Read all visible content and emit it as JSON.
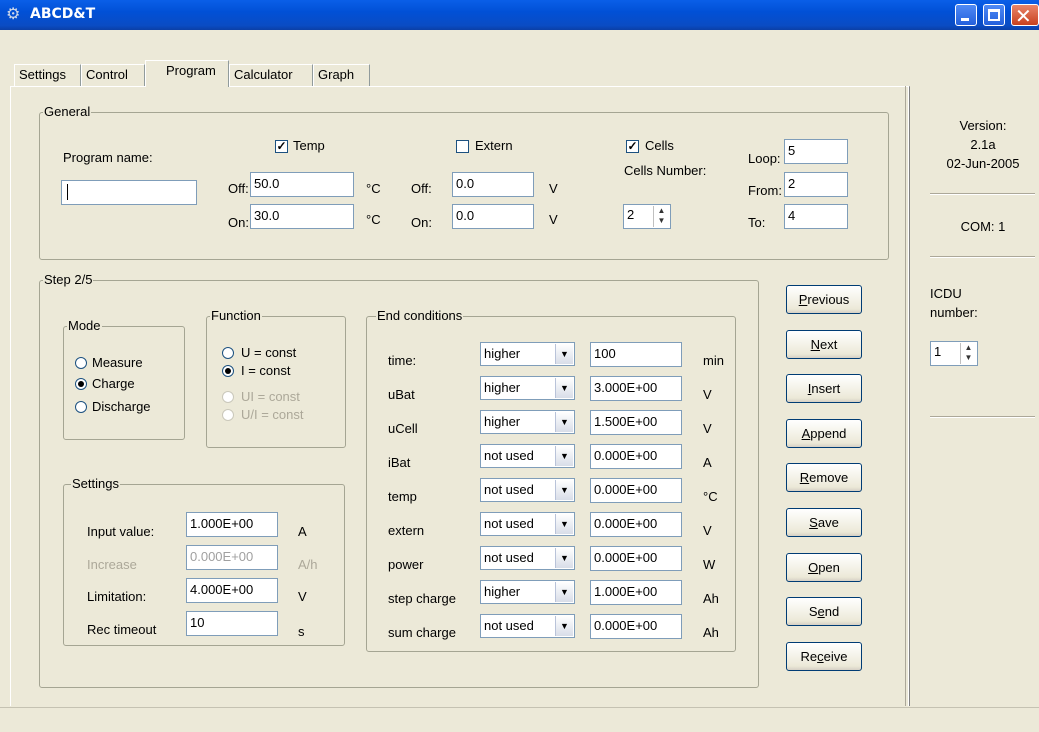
{
  "window": {
    "title": "ABCD&T"
  },
  "tabs": [
    "Settings",
    "Control",
    "Program",
    "Calculator",
    "Graph"
  ],
  "general": {
    "legend": "General",
    "program_name_label": "Program name:",
    "program_name_value": "",
    "temp": {
      "label": "Temp",
      "checked": true,
      "off_label": "Off:",
      "off_value": "50.0",
      "on_label": "On:",
      "on_value": "30.0",
      "unit": "°C"
    },
    "extern": {
      "label": "Extern",
      "checked": false,
      "off_label": "Off:",
      "off_value": "0.0",
      "on_label": "On:",
      "on_value": "0.0",
      "unit": "V"
    },
    "cells": {
      "label": "Cells",
      "checked": true,
      "number_label": "Cells Number:",
      "number_value": "2"
    },
    "loop": {
      "loop_label": "Loop:",
      "loop_value": "5",
      "from_label": "From:",
      "from_value": "2",
      "to_label": "To:",
      "to_value": "4"
    }
  },
  "step": {
    "legend": "Step 2/5",
    "mode": {
      "legend": "Mode",
      "options": [
        "Measure",
        "Charge",
        "Discharge"
      ],
      "selected": "Charge"
    },
    "function": {
      "legend": "Function",
      "options": [
        "U = const",
        "I = const",
        "UI = const",
        "U/I = const"
      ],
      "selected": "I = const"
    },
    "settings": {
      "legend": "Settings",
      "rows": [
        {
          "label": "Input value:",
          "value": "1.000E+00",
          "unit": "A"
        },
        {
          "label": "Increase",
          "value": "0.000E+00",
          "unit": "A/h"
        },
        {
          "label": "Limitation:",
          "value": "4.000E+00",
          "unit": "V"
        },
        {
          "label": "Rec timeout",
          "value": "10",
          "unit": "s"
        }
      ]
    },
    "end_conditions": {
      "legend": "End conditions",
      "rows": [
        {
          "label": "time:",
          "op": "higher",
          "value": "100",
          "unit": "min"
        },
        {
          "label": "uBat",
          "op": "higher",
          "value": "3.000E+00",
          "unit": "V"
        },
        {
          "label": "uCell",
          "op": "higher",
          "value": "1.500E+00",
          "unit": "V"
        },
        {
          "label": "iBat",
          "op": "not used",
          "value": "0.000E+00",
          "unit": "A"
        },
        {
          "label": "temp",
          "op": "not used",
          "value": "0.000E+00",
          "unit": "°C"
        },
        {
          "label": "extern",
          "op": "not used",
          "value": "0.000E+00",
          "unit": "V"
        },
        {
          "label": "power",
          "op": "not used",
          "value": "0.000E+00",
          "unit": "W"
        },
        {
          "label": "step charge",
          "op": "higher",
          "value": "1.000E+00",
          "unit": "Ah"
        },
        {
          "label": "sum charge",
          "op": "not used",
          "value": "0.000E+00",
          "unit": "Ah"
        }
      ]
    }
  },
  "buttons": [
    {
      "name": "previous",
      "pre": "",
      "key": "P",
      "post": "revious"
    },
    {
      "name": "next",
      "pre": "",
      "key": "N",
      "post": "ext"
    },
    {
      "name": "insert",
      "pre": "",
      "key": "I",
      "post": "nsert"
    },
    {
      "name": "append",
      "pre": "",
      "key": "A",
      "post": "ppend"
    },
    {
      "name": "remove",
      "pre": "",
      "key": "R",
      "post": "emove"
    },
    {
      "name": "save",
      "pre": "",
      "key": "S",
      "post": "ave"
    },
    {
      "name": "open",
      "pre": "",
      "key": "O",
      "post": "pen"
    },
    {
      "name": "send",
      "pre": "S",
      "key": "e",
      "post": "nd"
    },
    {
      "name": "receive",
      "pre": "Re",
      "key": "c",
      "post": "eive"
    }
  ],
  "side": {
    "version_label": "Version:",
    "version": "2.1a",
    "date": "02-Jun-2005",
    "com": "COM: 1",
    "icdu_label_1": "ICDU",
    "icdu_label_2": "number:",
    "icdu_value": "1"
  },
  "icons": {
    "app": "app-gear-icon",
    "minimize": "minimize-icon",
    "maximize": "maximize-icon",
    "close": "close-icon"
  },
  "colors": {
    "titlebar": "#0150d6",
    "face": "#ece9d8",
    "close": "#c8411f"
  }
}
